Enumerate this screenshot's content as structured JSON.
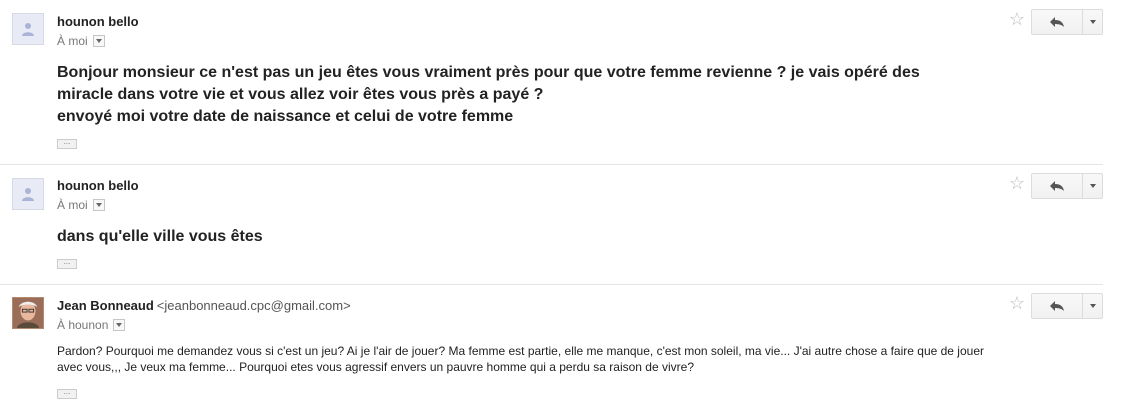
{
  "messages": [
    {
      "sender": "hounon bello",
      "email": "",
      "recipient": "À moi",
      "body_lines": [
        "Bonjour monsieur ce n'est pas un jeu êtes vous vraiment près pour que votre femme revienne ? je vais opéré des",
        "miracle dans votre vie et vous allez voir êtes vous près a payé ?",
        "envoyé moi votre date de naissance et celui de votre femme"
      ],
      "trimmed_indicator": "..."
    },
    {
      "sender": "hounon bello",
      "email": "",
      "recipient": "À moi",
      "body_lines": [
        "dans qu'elle ville vous êtes"
      ],
      "trimmed_indicator": "..."
    },
    {
      "sender": "Jean Bonneaud",
      "email": "<jeanbonneaud.cpc@gmail.com>",
      "recipient": "À hounon",
      "body_lines": [
        "Pardon? Pourquoi me demandez vous si c'est un jeu? Ai je l'air de jouer? Ma femme est partie, elle me manque, c'est mon soleil, ma vie... J'ai autre chose a faire que de jouer",
        "avec vous,,, Je veux ma femme... Pourquoi etes vous agressif envers un pauvre homme qui a perdu sa raison de vivre?"
      ],
      "trimmed_indicator": "..."
    }
  ],
  "icons": {
    "star": "☆",
    "reply": "reply-icon",
    "more": "chevron-down-icon"
  },
  "colors": {
    "border": "#dcdcdc",
    "text": "#222222",
    "muted": "#777777",
    "star": "#bbbbbb"
  }
}
